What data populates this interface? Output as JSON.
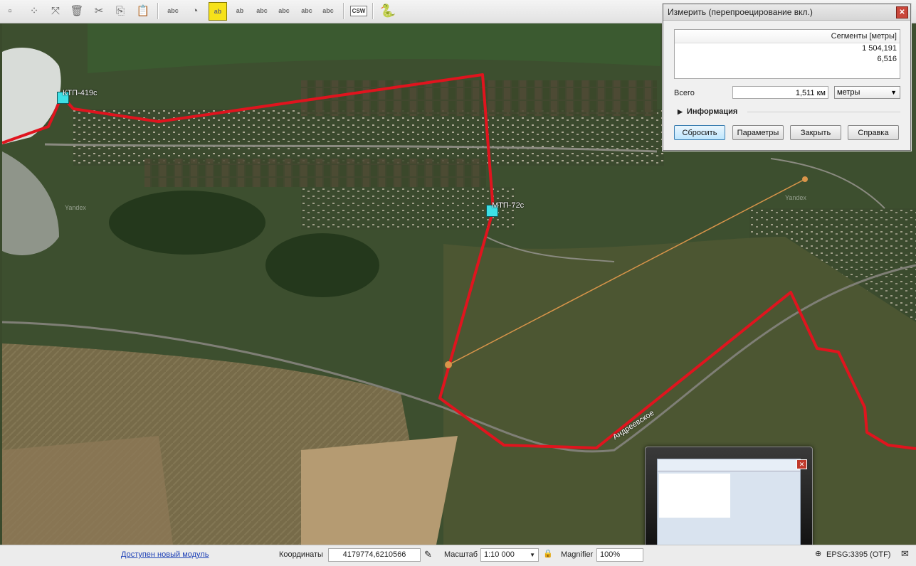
{
  "toolbar": {
    "buttons": [
      "add-feature-icon",
      "node-tool-icon",
      "move-feature-icon",
      "delete-selected-icon",
      "cut-features-icon",
      "copy-features-icon",
      "paste-features-icon",
      "label-icon",
      "pin-label-icon",
      "highlight-label-icon",
      "label-rotate-icon",
      "label-show-icon",
      "label-move-icon",
      "label-change-icon",
      "label-edit-icon"
    ],
    "csw_label": "CSW",
    "python_icon": "python-icon"
  },
  "map": {
    "labels": {
      "point_a": "КТП-419с",
      "point_b": "МТП-72с",
      "road": "Андреевское",
      "watermark_1": "Yandex",
      "watermark_2": "Yandex"
    },
    "colors": {
      "measure_line": "#e0141e",
      "rubber_band": "#d9954a",
      "feature": "#3de0e6"
    }
  },
  "dialog": {
    "title": "Измерить (перепроецирование вкл.)",
    "segments_header": "Сегменты [метры]",
    "segments": [
      "1 504,191",
      "6,516"
    ],
    "total_label": "Всего",
    "total_value": "1,511 км",
    "unit": "метры",
    "info_label": "Информация",
    "buttons": {
      "reset": "Сбросить",
      "params": "Параметры",
      "close": "Закрыть",
      "help": "Справка"
    }
  },
  "status": {
    "new_module": "Доступен новый модуль",
    "coords_label": "Координаты",
    "coords_value": "4179774,6210566",
    "scale_label": "Масштаб",
    "scale_value": "1:10 000",
    "magnifier_label": "Magnifier",
    "magnifier_value": "100%",
    "crs": "EPSG:3395 (OTF)"
  }
}
